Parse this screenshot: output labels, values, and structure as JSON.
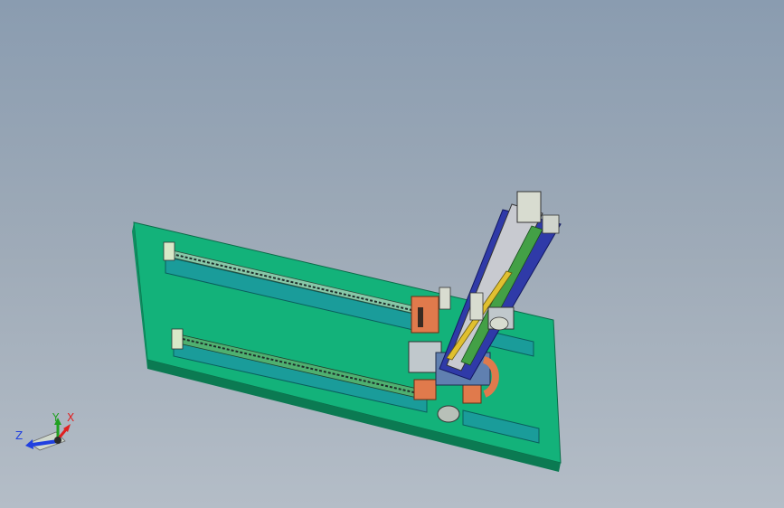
{
  "viewport": {
    "background_top": "#8a9cb0",
    "background_bottom": "#b4bdc7"
  },
  "model": {
    "base_plate_color": "#13b27a",
    "rail_color": "#1a9c9a",
    "carriage_color": "#e07a4c",
    "vertical_axis_colors": [
      "#2f3aa8",
      "#43a046",
      "#c8c8c8",
      "#e0c030"
    ]
  },
  "triad": {
    "x_label": "X",
    "y_label": "Y",
    "z_label": "Z",
    "x_color": "#e02020",
    "y_color": "#20a020",
    "z_color": "#2040e0"
  }
}
